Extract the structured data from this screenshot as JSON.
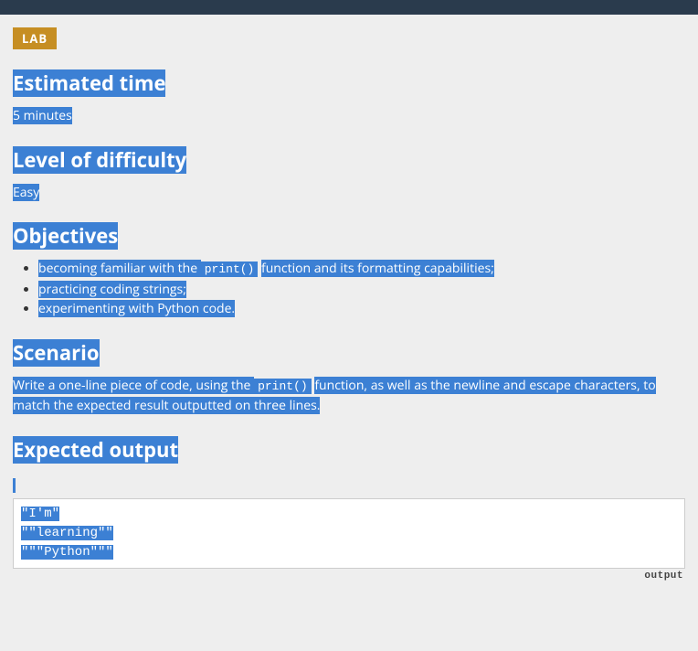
{
  "badge": "LAB",
  "sections": {
    "estimated_time": {
      "heading": "Estimated time",
      "value": "5 minutes"
    },
    "level": {
      "heading": "Level of difficulty",
      "value": "Easy"
    },
    "objectives": {
      "heading": "Objectives",
      "items": {
        "0_part1": "becoming familiar with the ",
        "0_code": "print()",
        "0_part2": " function and its formatting capabilities;",
        "1": "practicing coding strings;",
        "2": "experimenting with Python code."
      }
    },
    "scenario": {
      "heading": "Scenario",
      "text_part1": "Write a one-line piece of code, using the ",
      "text_code": "print()",
      "text_part2": " function, as well as the newline and escape characters, to match the expected result outputted on three lines."
    },
    "expected": {
      "heading": "Expected output",
      "lines": {
        "0": "\"I'm\"",
        "1": "\"\"learning\"\"",
        "2": "\"\"\"Python\"\"\""
      },
      "label": "output"
    }
  }
}
